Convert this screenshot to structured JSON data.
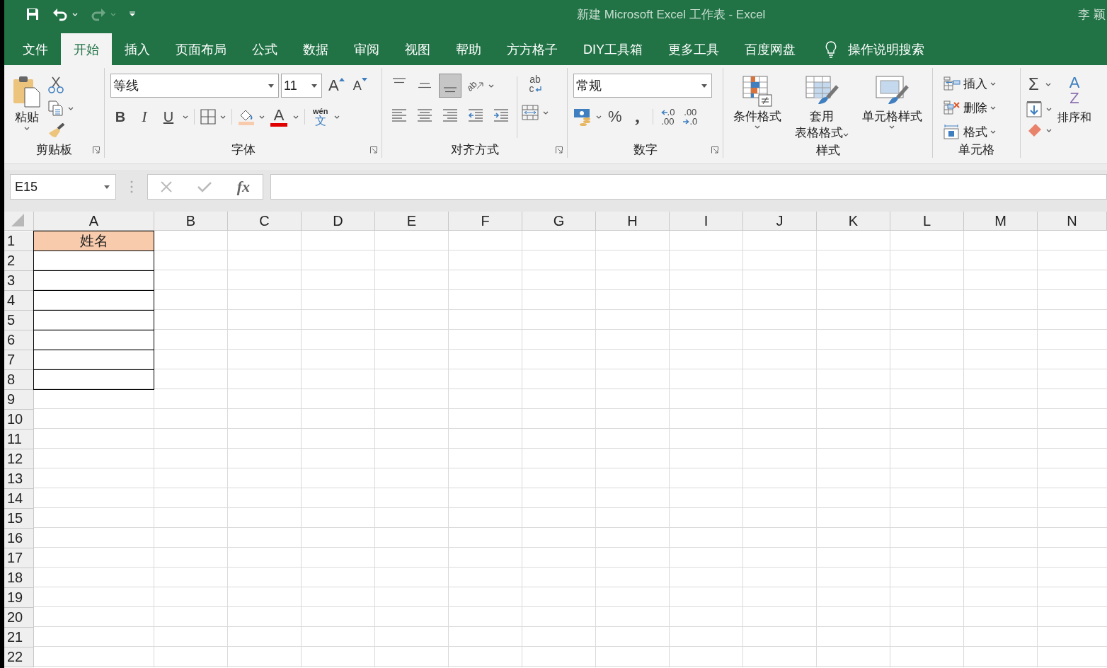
{
  "window": {
    "title": "新建 Microsoft Excel 工作表  -  Excel",
    "user": "李 颖"
  },
  "quick_access": [
    {
      "kind": "save",
      "disabled": false
    },
    {
      "kind": "undo",
      "disabled": false
    },
    {
      "kind": "redo",
      "disabled": true
    },
    {
      "kind": "customize",
      "disabled": false
    }
  ],
  "tabs": [
    {
      "label": "文件",
      "selected": false
    },
    {
      "label": "开始",
      "selected": true
    },
    {
      "label": "插入",
      "selected": false
    },
    {
      "label": "页面布局",
      "selected": false
    },
    {
      "label": "公式",
      "selected": false
    },
    {
      "label": "数据",
      "selected": false
    },
    {
      "label": "审阅",
      "selected": false
    },
    {
      "label": "视图",
      "selected": false
    },
    {
      "label": "帮助",
      "selected": false
    },
    {
      "label": "方方格子",
      "selected": false
    },
    {
      "label": "DIY工具箱",
      "selected": false
    },
    {
      "label": "更多工具",
      "selected": false
    },
    {
      "label": "百度网盘",
      "selected": false
    }
  ],
  "tell_me": {
    "label": "操作说明搜索"
  },
  "ribbon": {
    "clipboard": {
      "paste": "粘贴",
      "label": "剪贴板"
    },
    "font": {
      "font_name": "等线",
      "font_size": "11",
      "grow": "A",
      "shrink": "A",
      "bold": "B",
      "italic": "I",
      "underline": "U",
      "font_color": "A",
      "phonetic_top": "wén",
      "phonetic_bottom": "文",
      "label": "字体"
    },
    "alignment": {
      "vertical_align": [
        {
          "kind": "top",
          "selected": false
        },
        {
          "kind": "middle",
          "selected": false
        },
        {
          "kind": "bottom",
          "selected": true
        }
      ],
      "horizontal_align": [
        {
          "kind": "left",
          "selected": false
        },
        {
          "kind": "center",
          "selected": false
        },
        {
          "kind": "right",
          "selected": false
        },
        {
          "kind": "outdent",
          "selected": false
        },
        {
          "kind": "indent",
          "selected": false
        }
      ],
      "orientation": "ab",
      "wrap_top": "ab",
      "wrap_bottom": "c",
      "label": "对齐方式"
    },
    "number": {
      "format": "常规",
      "percent": "%",
      "comma": ",",
      "increase_decimal": [
        ".0",
        ".00"
      ],
      "decrease_decimal": [
        ".00",
        ".0"
      ],
      "label": "数字"
    },
    "styles": {
      "buttons": [
        {
          "kind": "conditional",
          "lines": [
            "条件格式"
          ]
        },
        {
          "kind": "table",
          "lines": [
            "套用",
            "表格格式"
          ]
        },
        {
          "kind": "cell",
          "lines": [
            "单元格样式"
          ]
        }
      ],
      "label": "样式"
    },
    "cells": {
      "buttons": [
        {
          "kind": "insert",
          "label": "插入"
        },
        {
          "kind": "delete",
          "label": "删除"
        },
        {
          "kind": "format",
          "label": "格式"
        }
      ],
      "label": "单元格"
    },
    "editing": {
      "sum": "Σ",
      "sort_top": "A",
      "sort_bottom": "Z",
      "sort_label": "排序和"
    }
  },
  "formula_bar": {
    "name_box": "E15",
    "fx": "fx"
  },
  "grid": {
    "columns": [
      "A",
      "B",
      "C",
      "D",
      "E",
      "F",
      "G",
      "H",
      "I",
      "J",
      "K",
      "L",
      "M",
      "N"
    ],
    "rows": [
      {
        "label": "1",
        "cell_a": {
          "text": "姓名",
          "color": "#f8cbad",
          "bordered": true
        }
      },
      {
        "label": "2",
        "cell_a": {
          "bordered": true
        }
      },
      {
        "label": "3",
        "cell_a": {
          "bordered": true
        }
      },
      {
        "label": "4",
        "cell_a": {
          "bordered": true
        }
      },
      {
        "label": "5",
        "cell_a": {
          "bordered": true
        }
      },
      {
        "label": "6",
        "cell_a": {
          "bordered": true
        }
      },
      {
        "label": "7",
        "cell_a": {
          "bordered": true
        }
      },
      {
        "label": "8",
        "cell_a": {
          "bordered": true
        }
      },
      {
        "label": "9",
        "cell_a": {
          "bordered": false
        }
      },
      {
        "label": "10",
        "cell_a": {
          "bordered": false
        }
      },
      {
        "label": "11",
        "cell_a": {
          "bordered": false
        }
      },
      {
        "label": "12",
        "cell_a": {
          "bordered": false
        }
      },
      {
        "label": "13",
        "cell_a": {
          "bordered": false
        }
      },
      {
        "label": "14",
        "cell_a": {
          "bordered": false
        }
      },
      {
        "label": "15",
        "cell_a": {
          "bordered": false
        }
      },
      {
        "label": "16",
        "cell_a": {
          "bordered": false
        }
      },
      {
        "label": "17",
        "cell_a": {
          "bordered": false
        }
      },
      {
        "label": "18",
        "cell_a": {
          "bordered": false
        }
      },
      {
        "label": "19",
        "cell_a": {
          "bordered": false
        }
      },
      {
        "label": "20",
        "cell_a": {
          "bordered": false
        }
      },
      {
        "label": "21",
        "cell_a": {
          "bordered": false
        }
      },
      {
        "label": "22",
        "cell_a": {
          "bordered": false
        }
      }
    ]
  }
}
